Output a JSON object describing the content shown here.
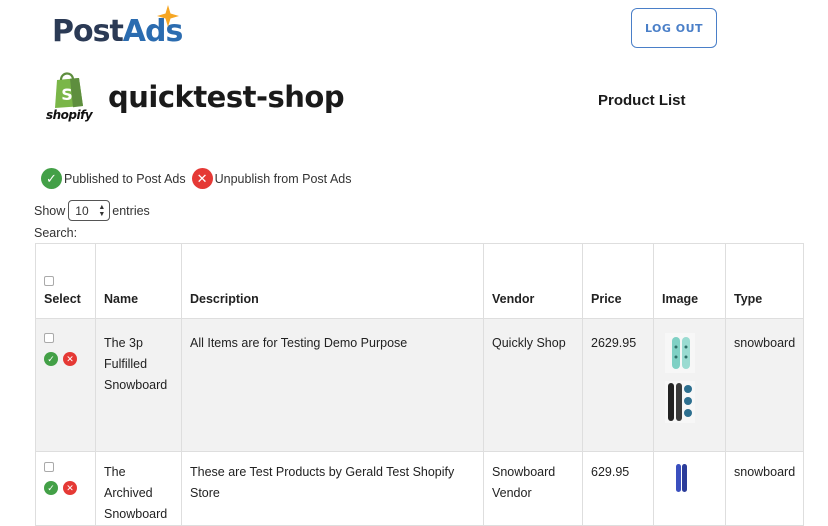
{
  "brand": {
    "post": "Post",
    "ads": "Ads"
  },
  "header": {
    "logout_label": "LOG OUT"
  },
  "shop": {
    "platform_label": "shopify",
    "name": "quicktest-shop"
  },
  "page": {
    "heading": "Product List"
  },
  "legend": {
    "published": "Published to Post Ads",
    "unpublish": "Unpublish from Post Ads"
  },
  "controls": {
    "show_label": "Show",
    "entries_value": "10",
    "entries_label": "entries",
    "search_label": "Search:"
  },
  "table": {
    "headers": [
      "Select",
      "Name",
      "Description",
      "Vendor",
      "Price",
      "Image",
      "Type"
    ],
    "rows": [
      {
        "name": "The 3p Fulfilled Snowboard",
        "description": "All Items are for Testing Demo Purpose",
        "vendor": "Quickly Shop",
        "price": "2629.95",
        "type": "snowboard"
      },
      {
        "name": "The Archived Snowboard",
        "description": "These are Test Products by Gerald  Test Shopify Store",
        "vendor": "Snowboard Vendor",
        "price": "629.95",
        "type": "snowboard"
      }
    ]
  },
  "colors": {
    "accent": "#4a7fc8",
    "brand_dark": "#2b3a55",
    "brand_blue": "#2b6cb0",
    "success": "#43a047",
    "danger": "#e53935",
    "row_stripe": "#f2f2f2"
  },
  "icons": {
    "published": "check-circle-icon",
    "unpublish": "x-circle-icon",
    "logo_badge": "sparkle-icon",
    "shopify": "shopping-bag-icon"
  }
}
